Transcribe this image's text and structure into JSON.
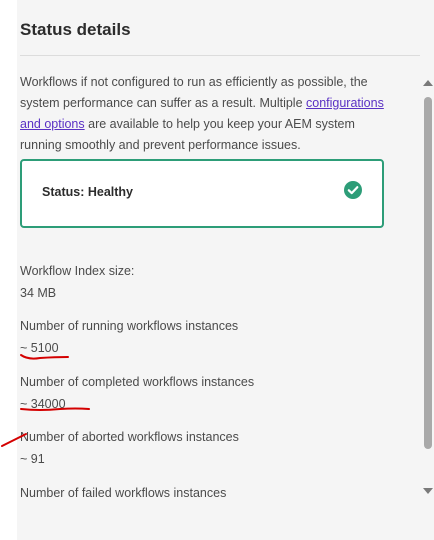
{
  "panel": {
    "title": "Status details",
    "intro_before": "Workflows if not configured to run as efficiently as possible, the system performance can suffer as a result. Multiple ",
    "intro_link": "configurations and options",
    "intro_after": " are available to help you keep your AEM system running smoothly and prevent performance issues."
  },
  "status": {
    "label": "Status: Healthy",
    "icon": "check-circle-icon",
    "color": "#2d9d78"
  },
  "metrics": [
    {
      "label": "Workflow Index size:",
      "value": "34 MB"
    },
    {
      "label": "Number of running workflows instances",
      "value": "~ 5100"
    },
    {
      "label": "Number of completed workflows instances",
      "value": "~ 34000"
    },
    {
      "label": "Number of aborted workflows instances",
      "value": "~ 91"
    },
    {
      "label": "Number of failed workflows instances",
      "value": ""
    }
  ],
  "annotation_color": "#d40000"
}
